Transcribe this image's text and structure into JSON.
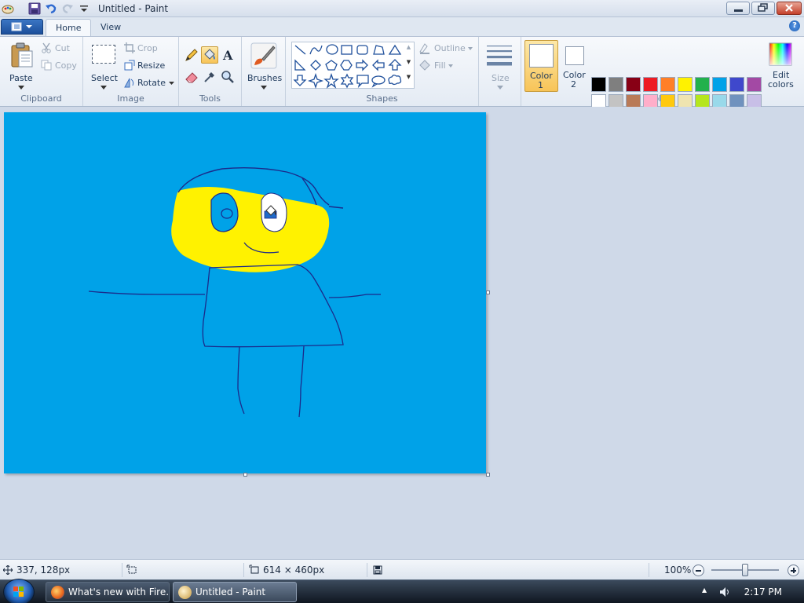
{
  "window": {
    "title": "Untitled - Paint"
  },
  "tabs": [
    {
      "label": "Home"
    },
    {
      "label": "View"
    }
  ],
  "ribbon": {
    "clipboard": {
      "label": "Clipboard",
      "paste": "Paste",
      "cut": "Cut",
      "copy": "Copy"
    },
    "image": {
      "label": "Image",
      "select": "Select",
      "crop": "Crop",
      "resize": "Resize",
      "rotate": "Rotate"
    },
    "tools": {
      "label": "Tools"
    },
    "brushes": {
      "label": "Brushes"
    },
    "shapes": {
      "label": "Shapes",
      "outline": "Outline",
      "fill": "Fill"
    },
    "size": {
      "label": "Size"
    },
    "color1": {
      "label": "Color",
      "num": "1",
      "value": "#ffffff"
    },
    "color2": {
      "label": "Color",
      "num": "2",
      "value": "#ffffff"
    },
    "colors": {
      "label": "Colors",
      "edit_label_1": "Edit",
      "edit_label_2": "colors",
      "row1": [
        "#000000",
        "#7f7f7f",
        "#880015",
        "#ed1c24",
        "#ff7f27",
        "#fff200",
        "#22b14c",
        "#00a2e8",
        "#3f48cc",
        "#a349a4"
      ],
      "row2": [
        "#ffffff",
        "#c3c3c3",
        "#b97a57",
        "#ffaec9",
        "#ffc90e",
        "#efe4b0",
        "#b5e61d",
        "#99d9ea",
        "#7092be",
        "#c8bfe7"
      ]
    }
  },
  "canvas": {
    "background": "#00a2e8"
  },
  "status": {
    "cursor_pos": "337, 128px",
    "canvas_size": "614 × 460px",
    "zoom": "100%",
    "zoom_fraction": 0.5
  },
  "taskbar": {
    "tasks": [
      {
        "label": "What's new with Fire..."
      },
      {
        "label": "Untitled - Paint"
      }
    ],
    "clock": "2:17 PM"
  }
}
